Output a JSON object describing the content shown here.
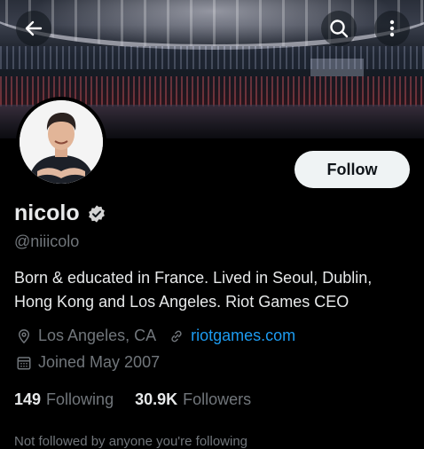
{
  "header": {
    "back_icon": "back-arrow-icon",
    "search_icon": "search-icon",
    "more_icon": "more-vertical-icon"
  },
  "profile": {
    "display_name": "nicolo",
    "verified_icon": "verified-badge-icon",
    "handle": "@niiicolo",
    "follow_label": "Follow",
    "bio_line1": "Born & educated in France. Lived in Seoul, Dublin,",
    "bio_line2": "Hong Kong and Los Angeles. Riot Games CEO",
    "location": "Los Angeles, CA",
    "location_icon": "location-pin-icon",
    "website": "riotgames.com",
    "link_icon": "link-icon",
    "joined": "Joined May 2007",
    "calendar_icon": "calendar-icon",
    "following_count": "149",
    "following_label": "Following",
    "followers_count": "30.9K",
    "followers_label": "Followers",
    "followed_by_partial": "Not followed by anyone you're following"
  },
  "colors": {
    "background": "#000000",
    "primary_text": "#e7e9ea",
    "secondary_text": "#71767b",
    "link": "#1d9bf0",
    "follow_button_bg": "#eff3f4"
  }
}
